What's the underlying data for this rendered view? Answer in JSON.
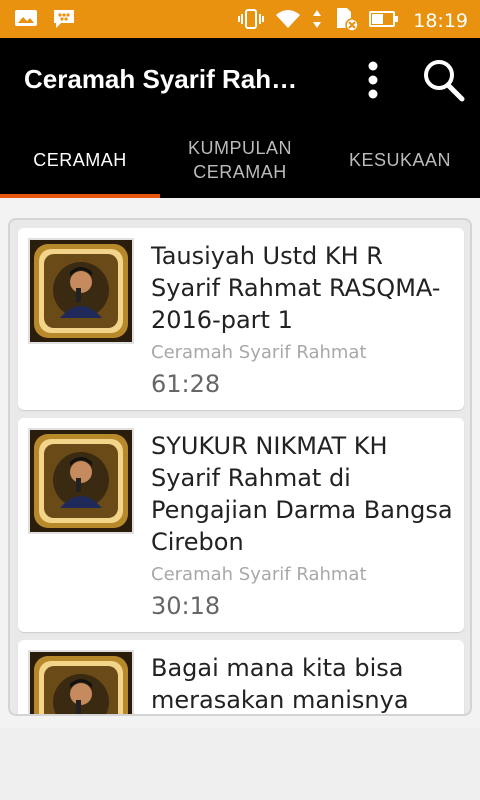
{
  "status_bar": {
    "time": "18:19",
    "left_icons": [
      "image-icon",
      "bbm-icon"
    ],
    "right_icons": [
      "vibrate-icon",
      "wifi-icon",
      "data-arrows-icon",
      "sim-no-card-icon",
      "battery-icon"
    ]
  },
  "toolbar": {
    "title": "Ceramah Syarif Rah…",
    "overflow_icon": "more-vert-icon",
    "search_icon": "search-icon"
  },
  "tabs": [
    {
      "label": "CERAMAH",
      "active": true
    },
    {
      "label": "KUMPULAN CERAMAH",
      "active": false
    },
    {
      "label": "KESUKAAN",
      "active": false
    }
  ],
  "videos": [
    {
      "title": "Tausiyah Ustd KH R Syarif Rahmat RASQMA-2016-part 1",
      "channel": "Ceramah Syarif Rahmat",
      "duration": "61:28"
    },
    {
      "title": "SYUKUR NIKMAT KH Syarif Rahmat di Pengajian Darma Bangsa Cirebon",
      "channel": "Ceramah Syarif Rahmat",
      "duration": "30:18"
    },
    {
      "title": "Bagai mana kita bisa merasakan manisnya",
      "channel": "",
      "duration": ""
    }
  ],
  "colors": {
    "status_bar": "#e8920f",
    "toolbar": "#000000",
    "tab_indicator": "#e8560f"
  }
}
